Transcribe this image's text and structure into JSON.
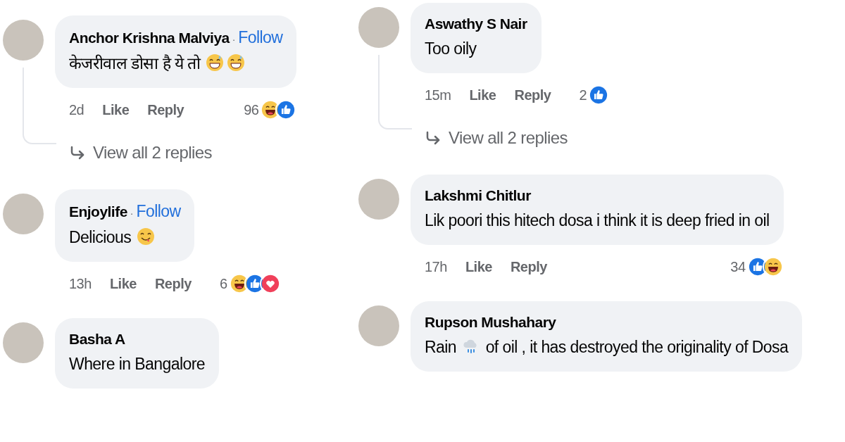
{
  "columns": [
    {
      "comments": [
        {
          "author": "Anchor Krishna Malviya",
          "separator": "·",
          "follow": "Follow",
          "body": [
            {
              "kind": "text",
              "text": "केजरीवाल डोसा है ये तो"
            },
            {
              "kind": "sweat-smile"
            },
            {
              "kind": "sweat-smile"
            }
          ],
          "time": "2d",
          "actions": [
            "Like",
            "Reply"
          ],
          "reaction_count": "96",
          "reactions": [
            {
              "kind": "haha"
            },
            {
              "kind": "like"
            }
          ],
          "replies_link": "View all 2 replies"
        },
        {
          "author": "Enjoylife",
          "separator": "·",
          "follow": "Follow",
          "body": [
            {
              "kind": "text",
              "text": "Delicious"
            },
            {
              "kind": "yum"
            }
          ],
          "time": "13h",
          "actions": [
            "Like",
            "Reply"
          ],
          "reaction_count": "6",
          "reactions": [
            {
              "kind": "haha"
            },
            {
              "kind": "like"
            },
            {
              "kind": "love"
            }
          ]
        },
        {
          "author": "Basha A",
          "body": [
            {
              "kind": "text",
              "text": "Where in Bangalore"
            }
          ]
        }
      ]
    },
    {
      "comments": [
        {
          "author": "Aswathy S Nair",
          "body": [
            {
              "kind": "text",
              "text": "Too oily"
            }
          ],
          "time": "15m",
          "actions": [
            "Like",
            "Reply"
          ],
          "reaction_count": "2",
          "reactions": [
            {
              "kind": "like"
            }
          ],
          "replies_link": "View all 2 replies"
        },
        {
          "author": "Lakshmi Chitlur",
          "body": [
            {
              "kind": "text",
              "text": "Lik poori this hitech dosa i think it is deep fried in oil"
            }
          ],
          "time": "17h",
          "actions": [
            "Like",
            "Reply"
          ],
          "reaction_count": "34",
          "reactions": [
            {
              "kind": "like"
            },
            {
              "kind": "haha"
            }
          ]
        },
        {
          "author": "Rupson Mushahary",
          "body": [
            {
              "kind": "text",
              "text": "Rain"
            },
            {
              "kind": "rain-cloud"
            },
            {
              "kind": "text",
              "text": "of oil , it has destroyed the originality of Dosa"
            }
          ]
        }
      ]
    }
  ]
}
